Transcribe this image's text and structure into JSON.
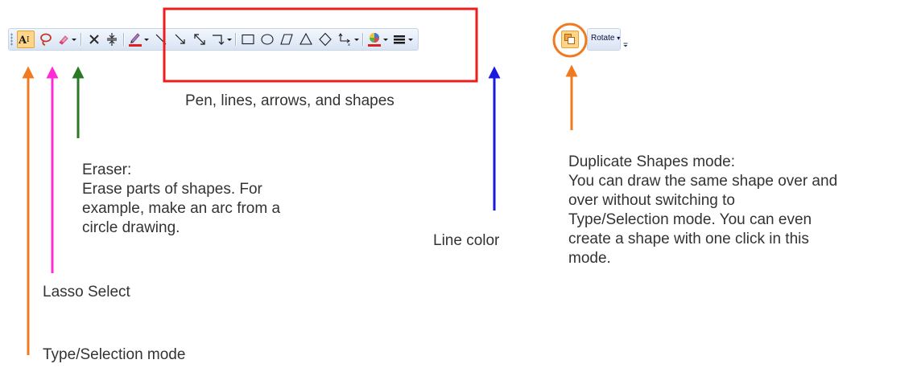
{
  "toolbar": {
    "tools": [
      {
        "name": "type-selection-tool"
      },
      {
        "name": "lasso-select-tool"
      },
      {
        "name": "eraser-tool"
      },
      {
        "name": "delete-tool"
      },
      {
        "name": "insert-space-tool"
      },
      {
        "name": "pen-tool"
      },
      {
        "name": "line-tool"
      },
      {
        "name": "arrow-tool"
      },
      {
        "name": "double-arrow-tool"
      },
      {
        "name": "connector-tool"
      },
      {
        "name": "rectangle-tool"
      },
      {
        "name": "ellipse-tool"
      },
      {
        "name": "parallelogram-tool"
      },
      {
        "name": "triangle-tool"
      },
      {
        "name": "diamond-tool"
      },
      {
        "name": "axis-tool"
      },
      {
        "name": "line-color-tool"
      },
      {
        "name": "line-weight-tool"
      },
      {
        "name": "duplicate-shapes-tool"
      }
    ],
    "rotate_label": "Rotate"
  },
  "annotations": {
    "shapes_label": "Pen, lines, arrows, and shapes",
    "eraser_text": "Eraser:\nErase parts of shapes. For\nexample, make an arc from a\ncircle drawing.",
    "line_color_label": "Line color",
    "duplicate_text": "Duplicate Shapes mode:\nYou can draw the same shape over and\nover without switching to\nType/Selection mode. You can even\ncreate a shape with one click in this\nmode.",
    "lasso_label": "Lasso Select",
    "type_selection_label": "Type/Selection mode"
  },
  "colors": {
    "arrow_orange": "#f07a1f",
    "arrow_magenta": "#ff2bd5",
    "arrow_green": "#2a7a25",
    "arrow_blue": "#1a1adf",
    "box_red": "#ee1c1c",
    "circle_orange": "#f07a1f",
    "pen_red": "#e02020"
  }
}
